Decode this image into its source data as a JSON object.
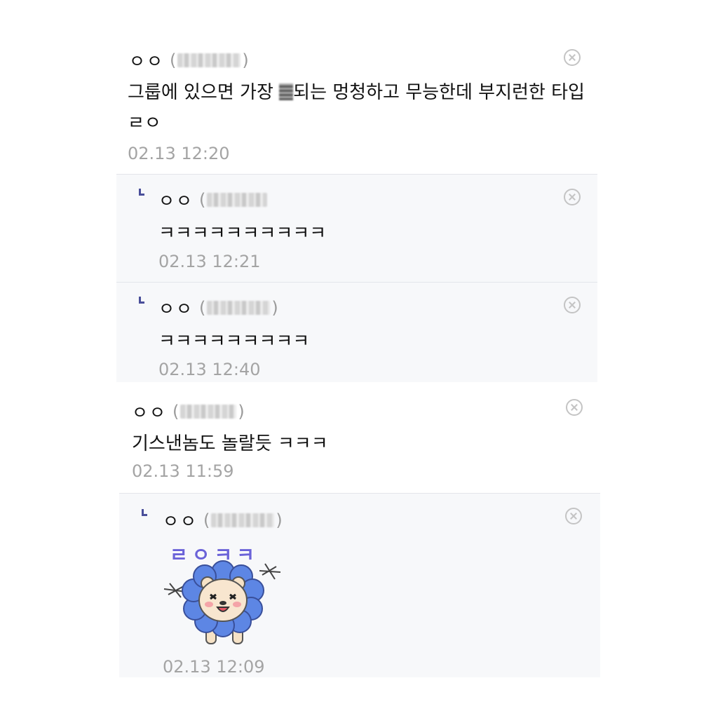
{
  "comments": [
    {
      "name": "ㅇㅇ",
      "ip_open": "(",
      "ip_close": ")",
      "text_before": "그룹에 있으면 가장 ",
      "text_after": "되는 멍청하고 무능한데 부지런한 타입 ㄹㅇ",
      "time": "02.13 12:20",
      "replies": [
        {
          "name": "ㅇㅇ",
          "ip_open": "(",
          "ip_close": "",
          "text": "ㅋㅋㅋㅋㅋㅋㅋㅋㅋㅋ",
          "time": "02.13 12:21"
        },
        {
          "name": "ㅇㅇ",
          "ip_open": "(",
          "ip_close": ")",
          "text": "ㅋㅋㅋㅋㅋㅋㅋㅋㅋ",
          "time": "02.13 12:40"
        }
      ]
    },
    {
      "name": "ㅇㅇ",
      "ip_open": "(",
      "ip_close": ")",
      "text": "기스낸놈도 놀랄듯 ㅋㅋㅋ",
      "time": "02.13 11:59",
      "replies": [
        {
          "name": "ㅇㅇ",
          "ip_open": "(",
          "ip_close": ")",
          "sticker_caption": "ㄹㅇㅋㅋ",
          "time": "02.13 12:09"
        }
      ]
    }
  ],
  "icons": {
    "close": "close-circle-icon",
    "reply": "reply-corner-icon",
    "censor": "censored-word-mosaic",
    "sticker": "lion-flower-sticker"
  },
  "colors": {
    "reply_background": "#f7f8fa",
    "divider": "#e3e5ea",
    "timestamp": "#a4a4a4",
    "reply_mark": "#4a4f9a",
    "close_icon": "#c4c4c4",
    "sticker_text": "#6b63d8"
  }
}
